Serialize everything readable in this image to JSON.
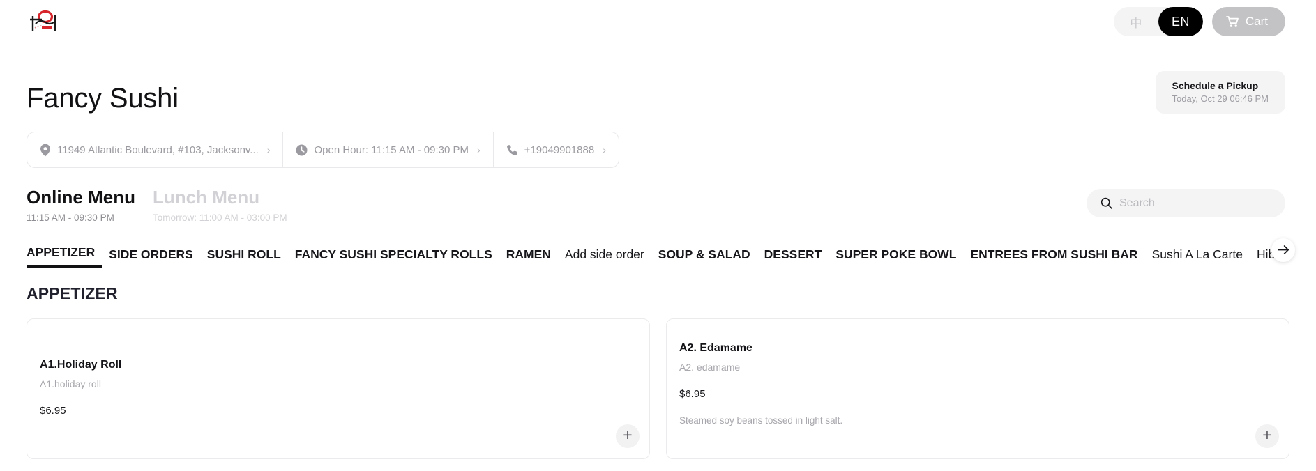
{
  "header": {
    "logo_alt": "Fancy Sushi logo",
    "languages": [
      {
        "label": "中",
        "code": "zh",
        "active": false
      },
      {
        "label": "EN",
        "code": "en",
        "active": true
      }
    ],
    "cart_label": "Cart",
    "cart_icon": "shopping-cart-icon"
  },
  "restaurant": {
    "name": "Fancy Sushi"
  },
  "pickup": {
    "title": "Schedule a Pickup",
    "subtitle": "Today, Oct 29 06:46 PM"
  },
  "info": {
    "address": {
      "icon": "location-pin-icon",
      "text": "11949 Atlantic Boulevard, #103, Jacksonv...",
      "chevron": "›"
    },
    "hours": {
      "icon": "clock-icon",
      "text": "Open Hour: 11:15 AM - 09:30 PM",
      "chevron": "›"
    },
    "phone": {
      "icon": "phone-icon",
      "text": "+19049901888",
      "chevron": "›"
    }
  },
  "menus": [
    {
      "name": "Online Menu",
      "hours": "11:15 AM - 09:30 PM",
      "active": true
    },
    {
      "name": "Lunch Menu",
      "hours": "Tomorrow: 11:00 AM - 03:00 PM",
      "active": false
    }
  ],
  "search": {
    "icon": "search-icon",
    "placeholder": "Search",
    "value": ""
  },
  "categories": [
    {
      "label": "APPETIZER",
      "active": true,
      "mixed_case": false
    },
    {
      "label": "SIDE ORDERS",
      "active": false,
      "mixed_case": false
    },
    {
      "label": "SUSHI ROLL",
      "active": false,
      "mixed_case": false
    },
    {
      "label": "FANCY SUSHI SPECIALTY ROLLS",
      "active": false,
      "mixed_case": false
    },
    {
      "label": "RAMEN",
      "active": false,
      "mixed_case": false
    },
    {
      "label": "Add side order",
      "active": false,
      "mixed_case": true
    },
    {
      "label": "SOUP & SALAD",
      "active": false,
      "mixed_case": false
    },
    {
      "label": "DESSERT",
      "active": false,
      "mixed_case": false
    },
    {
      "label": "SUPER POKE BOWL",
      "active": false,
      "mixed_case": false
    },
    {
      "label": "ENTREES FROM SUSHI BAR",
      "active": false,
      "mixed_case": false
    },
    {
      "label": "Sushi A La Carte",
      "active": false,
      "mixed_case": true
    },
    {
      "label": "Hibach",
      "active": false,
      "mixed_case": true
    }
  ],
  "categories_scroll_icon": "arrow-right-icon",
  "section": {
    "title": "APPETIZER"
  },
  "items": [
    {
      "name": "A1.Holiday Roll",
      "alt_name": "A1.holiday roll",
      "price": "$6.95",
      "description": "",
      "add_icon": "plus-icon"
    },
    {
      "name": "A2. Edamame",
      "alt_name": "A2. edamame",
      "price": "$6.95",
      "description": "Steamed soy beans tossed in light salt.",
      "add_icon": "plus-icon"
    }
  ],
  "colors": {
    "accent": "#000000",
    "logo_red": "#d7262c",
    "cart_bg": "#c3c3c6",
    "muted": "#a6a6ac",
    "border": "#ebebee"
  }
}
